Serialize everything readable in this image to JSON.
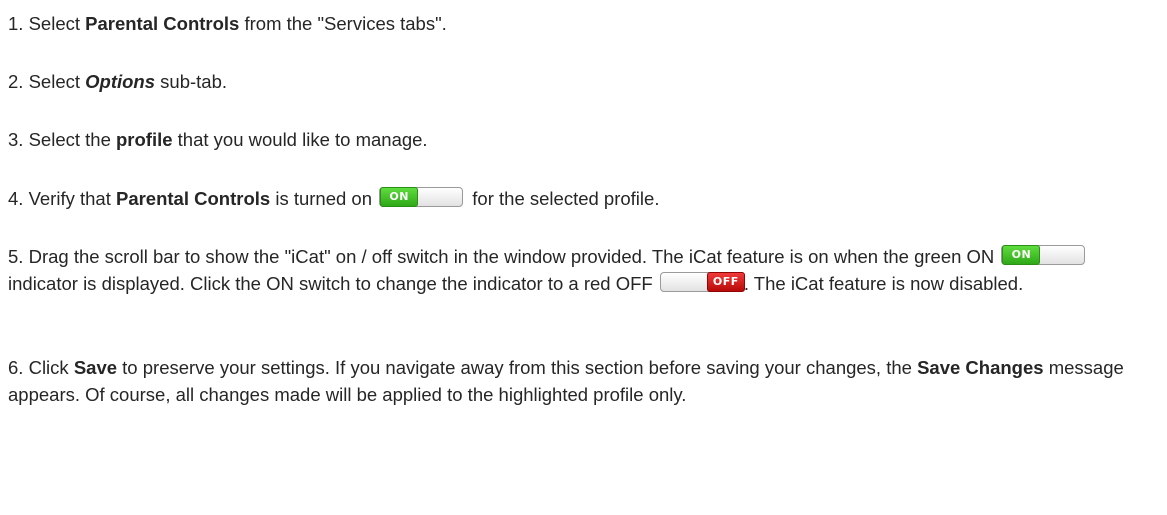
{
  "steps": [
    {
      "num": "1.",
      "pre": "Select",
      "bold": "Parental Controls",
      "post": "from the \"Services tabs\"."
    },
    {
      "num": "2.",
      "pre": "Select",
      "bold_italic": "Options",
      "post": "sub-tab."
    },
    {
      "num": "3.",
      "pre": "Select the",
      "bold": "profile",
      "post": "that you would like to manage."
    },
    {
      "num": "4.",
      "pre": "Verify that",
      "bold": "Parental Controls",
      "mid": "is turned on",
      "post": "for the selected profile."
    },
    {
      "num": "5.",
      "text1": "Drag the scroll bar to show the \"iCat\" on / off switch in the window provided. The iCat feature is on when the green ON",
      "text2": "indicator is displayed. Click the ON switch to change the indicator to a red OFF",
      "text3": ". The iCat feature is now disabled."
    },
    {
      "num": "6.",
      "pre": "Click",
      "bold1": "Save",
      "mid": "to preserve your settings. If you navigate away from this section before saving your changes, the",
      "bold2": "Save Changes",
      "post": "message appears. Of course, all changes made will be applied to the highlighted profile only."
    }
  ],
  "toggle": {
    "on_label": "ON",
    "off_label": "OFF",
    "on_color": "#3cc224",
    "off_color": "#d41414"
  }
}
